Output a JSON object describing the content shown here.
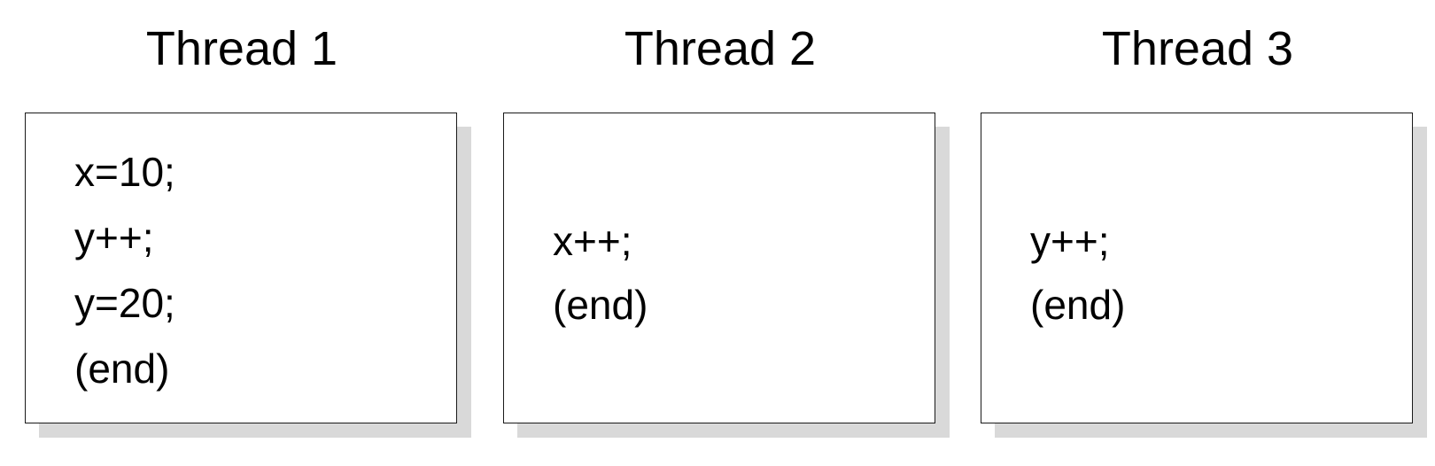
{
  "threads": [
    {
      "title": "Thread 1",
      "lines": [
        "x=10;",
        "y++;",
        "y=20;",
        "(end)"
      ]
    },
    {
      "title": "Thread 2",
      "lines": [
        "x++;",
        "(end)"
      ]
    },
    {
      "title": "Thread 3",
      "lines": [
        "y++;",
        "(end)"
      ]
    }
  ],
  "colors": {
    "border": "#1a1a1a",
    "shadow": "#d9d9d9",
    "text": "#000000"
  }
}
